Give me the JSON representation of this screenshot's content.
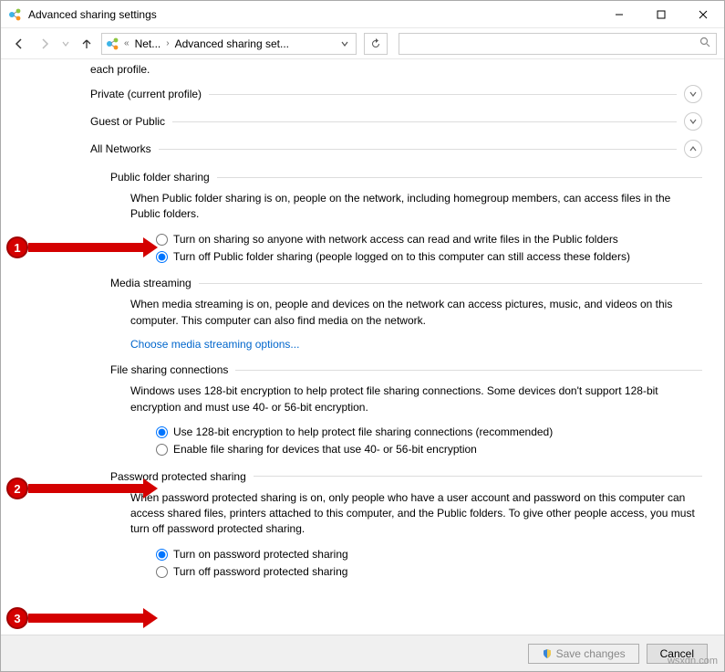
{
  "titlebar": {
    "title": "Advanced sharing settings"
  },
  "breadcrumb": {
    "root": "Net...",
    "current": "Advanced sharing set..."
  },
  "search": {
    "placeholder": ""
  },
  "intro": "each profile.",
  "sections": {
    "private": {
      "label": "Private (current profile)"
    },
    "guest": {
      "label": "Guest or Public"
    },
    "all": {
      "label": "All Networks"
    }
  },
  "public_folder": {
    "title": "Public folder sharing",
    "desc": "When Public folder sharing is on, people on the network, including homegroup members, can access files in the Public folders.",
    "opt_on": "Turn on sharing so anyone with network access can read and write files in the Public folders",
    "opt_off": "Turn off Public folder sharing (people logged on to this computer can still access these folders)"
  },
  "media": {
    "title": "Media streaming",
    "desc": "When media streaming is on, people and devices on the network can access pictures, music, and videos on this computer. This computer can also find media on the network.",
    "link": "Choose media streaming options..."
  },
  "file_conn": {
    "title": "File sharing connections",
    "desc": "Windows uses 128-bit encryption to help protect file sharing connections. Some devices don't support 128-bit encryption and must use 40- or 56-bit encryption.",
    "opt_128": "Use 128-bit encryption to help protect file sharing connections (recommended)",
    "opt_40": "Enable file sharing for devices that use 40- or 56-bit encryption"
  },
  "password": {
    "title": "Password protected sharing",
    "desc": "When password protected sharing is on, only people who have a user account and password on this computer can access shared files, printers attached to this computer, and the Public folders. To give other people access, you must turn off password protected sharing.",
    "opt_on": "Turn on password protected sharing",
    "opt_off": "Turn off password protected sharing"
  },
  "footer": {
    "save": "Save changes",
    "cancel": "Cancel"
  },
  "annotations": [
    "1",
    "2",
    "3"
  ],
  "watermark": "wsxdn.com"
}
